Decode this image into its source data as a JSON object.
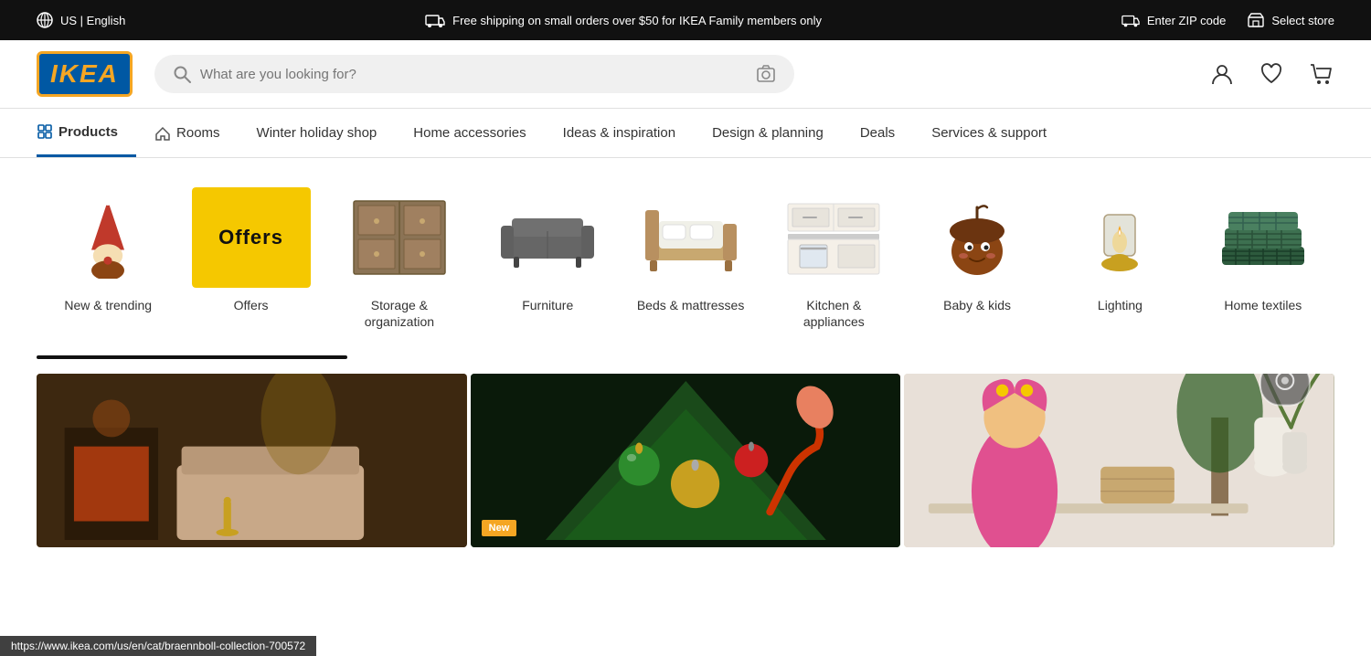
{
  "topbar": {
    "locale": "US | English",
    "shipping_notice": "Free shipping on small orders over $50 for IKEA Family members only",
    "zip_label": "Enter ZIP code",
    "store_label": "Select store"
  },
  "header": {
    "logo_text": "IKEA",
    "search_placeholder": "What are you looking for?"
  },
  "nav": {
    "items": [
      {
        "label": "Products",
        "active": true
      },
      {
        "label": "Rooms",
        "active": false
      },
      {
        "label": "Winter holiday shop",
        "active": false
      },
      {
        "label": "Home accessories",
        "active": false
      },
      {
        "label": "Ideas & inspiration",
        "active": false
      },
      {
        "label": "Design & planning",
        "active": false
      },
      {
        "label": "Deals",
        "active": false
      },
      {
        "label": "Services & support",
        "active": false
      }
    ]
  },
  "categories": [
    {
      "id": "new-trending",
      "label": "New & trending",
      "type": "image"
    },
    {
      "id": "offers",
      "label": "Offers",
      "type": "deals"
    },
    {
      "id": "storage-organization",
      "label": "Storage & organization",
      "type": "image"
    },
    {
      "id": "furniture",
      "label": "Furniture",
      "type": "image"
    },
    {
      "id": "beds-mattresses",
      "label": "Beds & mattresses",
      "type": "image"
    },
    {
      "id": "kitchen-appliances",
      "label": "Kitchen & appliances",
      "type": "image"
    },
    {
      "id": "baby-kids",
      "label": "Baby & kids",
      "type": "image"
    },
    {
      "id": "lighting",
      "label": "Lighting",
      "type": "image"
    },
    {
      "id": "home-textiles",
      "label": "Home textiles",
      "type": "image"
    }
  ],
  "status_bar": {
    "url": "https://www.ikea.com/us/en/cat/braennboll-collection-700572"
  },
  "panels": [
    {
      "id": "panel-holiday",
      "badge": ""
    },
    {
      "id": "panel-ornaments",
      "badge": "New"
    },
    {
      "id": "panel-kids",
      "badge": ""
    }
  ]
}
